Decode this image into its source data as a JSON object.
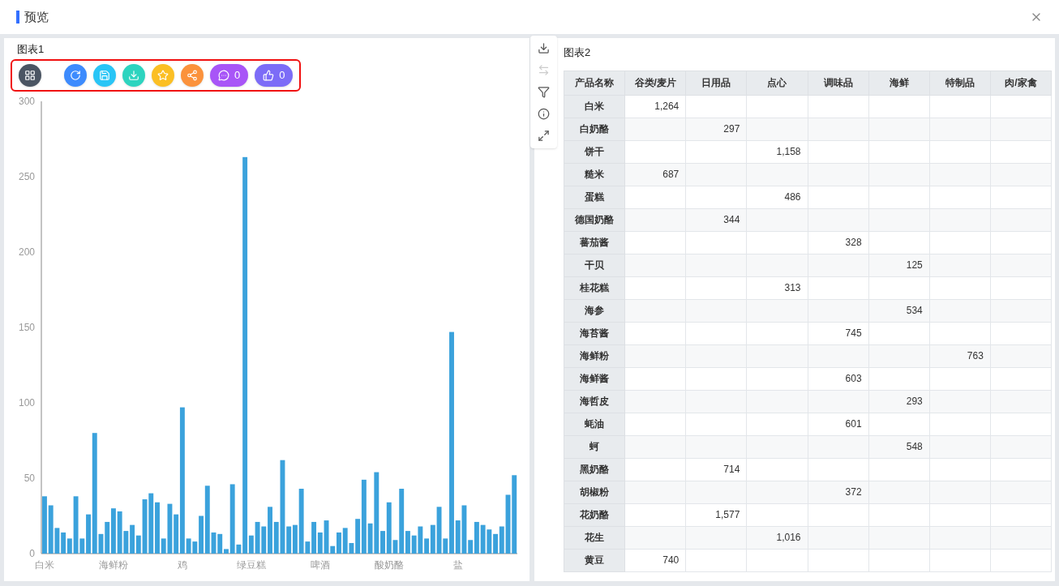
{
  "window": {
    "title": "预览"
  },
  "chart_panel": {
    "title": "图表1",
    "toolbar": [
      {
        "kind": "grid"
      },
      {
        "kind": "refresh"
      },
      {
        "kind": "save"
      },
      {
        "kind": "download"
      },
      {
        "kind": "star"
      },
      {
        "kind": "share"
      },
      {
        "kind": "comment",
        "count": "0"
      },
      {
        "kind": "like",
        "count": "0"
      }
    ],
    "chart_data": {
      "type": "bar",
      "ylim": [
        0,
        300
      ],
      "yticks": [
        0,
        50,
        100,
        150,
        200,
        250,
        300
      ],
      "categories": [
        "白米",
        null,
        null,
        null,
        null,
        null,
        null,
        null,
        null,
        null,
        null,
        "海鲜粉",
        null,
        null,
        null,
        null,
        null,
        null,
        null,
        null,
        null,
        null,
        "鸡",
        null,
        null,
        null,
        null,
        null,
        null,
        null,
        null,
        null,
        null,
        "绿豆糕",
        null,
        null,
        null,
        null,
        null,
        null,
        null,
        null,
        null,
        null,
        "啤酒",
        null,
        null,
        null,
        null,
        null,
        null,
        null,
        null,
        null,
        null,
        "酸奶酪",
        null,
        null,
        null,
        null,
        null,
        null,
        null,
        null,
        null,
        null,
        "盐",
        null,
        null,
        null,
        null,
        null,
        null,
        null,
        null,
        null
      ],
      "values": [
        38,
        32,
        17,
        14,
        10,
        38,
        10,
        26,
        80,
        13,
        21,
        30,
        28,
        15,
        19,
        12,
        36,
        40,
        34,
        10,
        33,
        26,
        97,
        10,
        8,
        25,
        45,
        14,
        13,
        3,
        46,
        6,
        263,
        12,
        21,
        18,
        31,
        21,
        62,
        18,
        19,
        43,
        8,
        21,
        14,
        22,
        5,
        14,
        17,
        7,
        23,
        49,
        20,
        54,
        15,
        34,
        9,
        43,
        15,
        12,
        18,
        10,
        19,
        31,
        10,
        147,
        22,
        32,
        9,
        21,
        19,
        16,
        13,
        18,
        39,
        52
      ]
    }
  },
  "side_toolbar": [
    {
      "kind": "download",
      "disabled": false
    },
    {
      "kind": "swap",
      "disabled": true
    },
    {
      "kind": "filter",
      "disabled": false
    },
    {
      "kind": "info",
      "disabled": false
    },
    {
      "kind": "expand",
      "disabled": false
    }
  ],
  "table_panel": {
    "title": "图表2",
    "columns": [
      "产品名称",
      "谷类/麦片",
      "日用品",
      "点心",
      "调味品",
      "海鲜",
      "特制品",
      "肉/家禽"
    ],
    "rows": [
      [
        "白米",
        "1,264",
        "",
        "",
        "",
        "",
        "",
        ""
      ],
      [
        "白奶酪",
        "",
        "297",
        "",
        "",
        "",
        "",
        ""
      ],
      [
        "饼干",
        "",
        "",
        "1,158",
        "",
        "",
        "",
        ""
      ],
      [
        "糙米",
        "687",
        "",
        "",
        "",
        "",
        "",
        ""
      ],
      [
        "蛋糕",
        "",
        "",
        "486",
        "",
        "",
        "",
        ""
      ],
      [
        "德国奶酪",
        "",
        "344",
        "",
        "",
        "",
        "",
        ""
      ],
      [
        "蕃茄酱",
        "",
        "",
        "",
        "328",
        "",
        "",
        ""
      ],
      [
        "干贝",
        "",
        "",
        "",
        "",
        "125",
        "",
        ""
      ],
      [
        "桂花糕",
        "",
        "",
        "313",
        "",
        "",
        "",
        ""
      ],
      [
        "海参",
        "",
        "",
        "",
        "",
        "534",
        "",
        ""
      ],
      [
        "海苔酱",
        "",
        "",
        "",
        "745",
        "",
        "",
        ""
      ],
      [
        "海鲜粉",
        "",
        "",
        "",
        "",
        "",
        "763",
        ""
      ],
      [
        "海鲜酱",
        "",
        "",
        "",
        "603",
        "",
        "",
        ""
      ],
      [
        "海哲皮",
        "",
        "",
        "",
        "",
        "293",
        "",
        ""
      ],
      [
        "蚝油",
        "",
        "",
        "",
        "601",
        "",
        "",
        ""
      ],
      [
        "蚵",
        "",
        "",
        "",
        "",
        "548",
        "",
        ""
      ],
      [
        "黑奶酪",
        "",
        "714",
        "",
        "",
        "",
        "",
        ""
      ],
      [
        "胡椒粉",
        "",
        "",
        "",
        "372",
        "",
        "",
        ""
      ],
      [
        "花奶酪",
        "",
        "1,577",
        "",
        "",
        "",
        "",
        ""
      ],
      [
        "花生",
        "",
        "",
        "1,016",
        "",
        "",
        "",
        ""
      ],
      [
        "黄豆",
        "740",
        "",
        "",
        "",
        "",
        "",
        ""
      ]
    ]
  }
}
